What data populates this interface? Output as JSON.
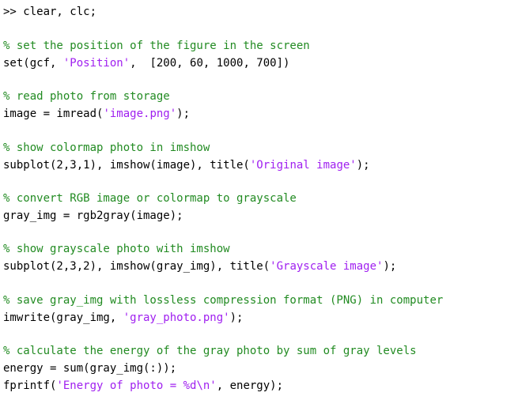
{
  "colors": {
    "code": "#000000",
    "comment": "#228B22",
    "string": "#A020F0",
    "background": "#FFFFFF"
  },
  "lines": [
    [
      {
        "t": ">> clear, clc;",
        "k": "code"
      }
    ],
    [
      {
        "t": "% set the position of the figure in the screen",
        "k": "comment"
      }
    ],
    [
      {
        "t": "set(gcf, ",
        "k": "code"
      },
      {
        "t": "'Position'",
        "k": "string"
      },
      {
        "t": ",  [200, 60, 1000, 700])",
        "k": "code"
      }
    ],
    [
      {
        "t": "% read photo from storage",
        "k": "comment"
      }
    ],
    [
      {
        "t": "image = imread(",
        "k": "code"
      },
      {
        "t": "'image.png'",
        "k": "string"
      },
      {
        "t": ");",
        "k": "code"
      }
    ],
    [
      {
        "t": "% show colormap photo in imshow",
        "k": "comment"
      }
    ],
    [
      {
        "t": "subplot(2,3,1), imshow(image), title(",
        "k": "code"
      },
      {
        "t": "'Original image'",
        "k": "string"
      },
      {
        "t": ");",
        "k": "code"
      }
    ],
    [
      {
        "t": "% convert RGB image or colormap to grayscale",
        "k": "comment"
      }
    ],
    [
      {
        "t": "gray_img = rgb2gray(image);",
        "k": "code"
      }
    ],
    [
      {
        "t": "% show grayscale photo with imshow",
        "k": "comment"
      }
    ],
    [
      {
        "t": "subplot(2,3,2), imshow(gray_img), title(",
        "k": "code"
      },
      {
        "t": "'Grayscale image'",
        "k": "string"
      },
      {
        "t": ");",
        "k": "code"
      }
    ],
    [
      {
        "t": "% save gray_img with lossless compression format (PNG) in computer",
        "k": "comment"
      }
    ],
    [
      {
        "t": "imwrite(gray_img, ",
        "k": "code"
      },
      {
        "t": "'gray_photo.png'",
        "k": "string"
      },
      {
        "t": ");",
        "k": "code"
      }
    ],
    [
      {
        "t": "% calculate the energy of the gray photo by sum of gray levels",
        "k": "comment"
      }
    ],
    [
      {
        "t": "energy = sum(gray_img(:));",
        "k": "code"
      }
    ],
    [
      {
        "t": "fprintf(",
        "k": "code"
      },
      {
        "t": "'Energy of photo = %d\\n'",
        "k": "string"
      },
      {
        "t": ", energy);",
        "k": "code"
      }
    ]
  ]
}
